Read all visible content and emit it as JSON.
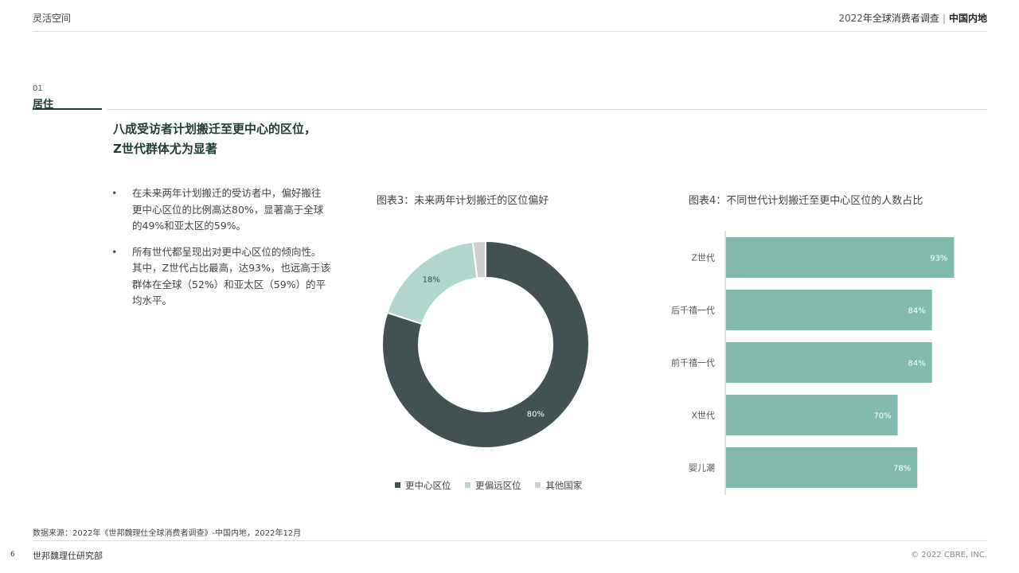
{
  "header": {
    "left_title": "灵活空间",
    "report_year": "2022",
    "report_name": "年全球消费者调查",
    "separator": "|",
    "region": "中国内地"
  },
  "section": {
    "number": "01",
    "title": "居住"
  },
  "headline": {
    "line1": "八成受访者计划搬迁至更中心的区位，",
    "line2": "Z世代群体尤为显著"
  },
  "bullets": [
    "在未来两年计划搬迁的受访者中，偏好搬往更中心区位的比例高达80%，显著高于全球的49%和亚太区的59%。",
    "所有世代都呈现出对更中心区位的倾向性。其中，Z世代占比最高，达93%，也远高于该群体在全球（52%）和亚太区（59%）的平均水平。"
  ],
  "bullet_marker": "•",
  "chart_data": [
    {
      "type": "pie",
      "title": "图表3：未来两年计划搬迁的区位偏好",
      "categories": [
        "更中心区位",
        "更偏远区位",
        "其他国家"
      ],
      "values": [
        80,
        18,
        2
      ],
      "data_labels": [
        "80%",
        "18%",
        ""
      ],
      "colors": [
        "#425151",
        "#b2d5cd",
        "#cfcfcf"
      ],
      "legend_position": "bottom"
    },
    {
      "type": "bar",
      "orientation": "horizontal",
      "title": "图表4：不同世代计划搬迁至更中心区位的人数占比",
      "categories": [
        "Z世代",
        "后千禧一代",
        "前千禧一代",
        "X世代",
        "婴儿潮"
      ],
      "values": [
        93,
        84,
        84,
        70,
        78
      ],
      "data_labels": [
        "93%",
        "84%",
        "84%",
        "70%",
        "78%"
      ],
      "color": "#82bbad",
      "xlim": [
        0,
        100
      ]
    }
  ],
  "footer": {
    "source": "数据来源：2022年《世邦魏理仕全球消费者调查》-中国内地，2022年12月",
    "page_number": "6",
    "org": "世邦魏理仕研究部",
    "copyright": "© 2022 CBRE, INC."
  }
}
